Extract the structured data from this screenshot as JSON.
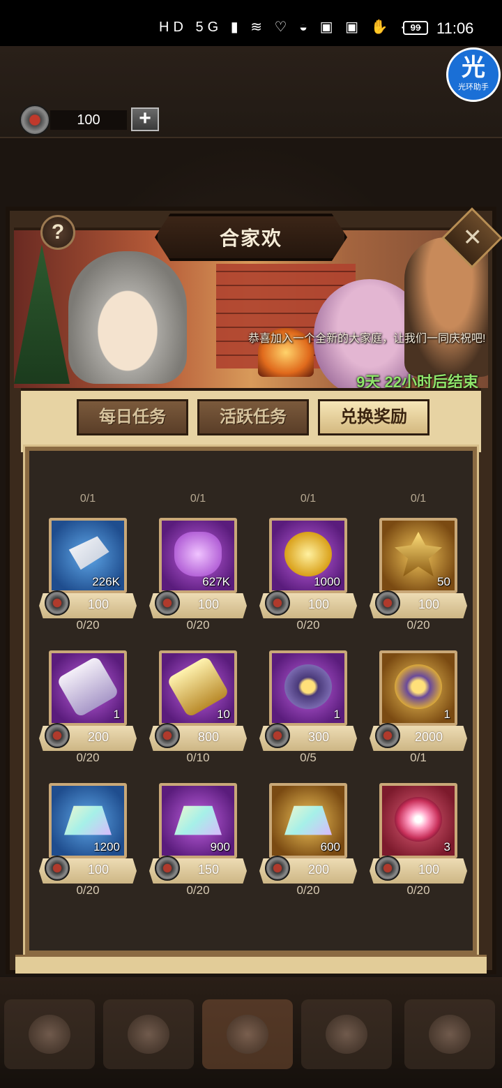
{
  "status_bar": {
    "icons": "HD 5G ▮ ≋ ♡ ◒ ▣ ▣ ✋ ···",
    "battery": "99",
    "time": "11:06"
  },
  "currency": {
    "value": "100",
    "add_symbol": "+"
  },
  "assistant_badge": {
    "glyph": "光",
    "label": "光环助手"
  },
  "event": {
    "title": "合家欢",
    "help_symbol": "?",
    "close_symbol": "✕",
    "message": "恭喜加入一个全新的大家庭，让我们一同庆祝吧!",
    "timer": "9天 22小时后结束"
  },
  "tabs": [
    {
      "label": "每日任务",
      "active": false
    },
    {
      "label": "活跃任务",
      "active": false
    },
    {
      "label": "兑换奖励",
      "active": true
    }
  ],
  "top_limits": [
    "0/1",
    "0/1",
    "0/1",
    "0/1"
  ],
  "items": [
    {
      "icon": "silver-ingot-icon",
      "rarity": "blue",
      "qty": "226K",
      "price": "100",
      "count": "0/20"
    },
    {
      "icon": "potion-bag-icon",
      "rarity": "purple",
      "qty": "627K",
      "price": "100",
      "count": "0/20"
    },
    {
      "icon": "gold-coin-icon",
      "rarity": "purple",
      "qty": "1000",
      "price": "100",
      "count": "0/20"
    },
    {
      "icon": "star-crystal-icon",
      "rarity": "gold",
      "qty": "50",
      "price": "100",
      "count": "0/20"
    },
    {
      "icon": "scroll-icon",
      "rarity": "purple",
      "qty": "1",
      "price": "200",
      "count": "0/20"
    },
    {
      "icon": "gold-scroll-icon",
      "rarity": "purple",
      "qty": "10",
      "price": "800",
      "count": "0/10"
    },
    {
      "icon": "medal-icon",
      "rarity": "purple",
      "qty": "1",
      "price": "300",
      "count": "0/5"
    },
    {
      "icon": "gold-medal-icon",
      "rarity": "gold",
      "qty": "1",
      "price": "2000",
      "count": "0/1"
    },
    {
      "icon": "crystal-shard-icon",
      "rarity": "blue",
      "qty": "1200",
      "price": "100",
      "count": "0/20"
    },
    {
      "icon": "crystal-shard-icon",
      "rarity": "purple",
      "qty": "900",
      "price": "150",
      "count": "0/20"
    },
    {
      "icon": "crystal-shard-icon",
      "rarity": "gold",
      "qty": "600",
      "price": "200",
      "count": "0/20"
    },
    {
      "icon": "swirl-orb-icon",
      "rarity": "red",
      "qty": "3",
      "price": "100",
      "count": "0/20"
    }
  ],
  "colors": {
    "blue_rarity": "#1f4d8e",
    "purple_rarity": "#5a1c7c",
    "gold_rarity": "#7a4a12",
    "red_rarity": "#7c1a2c",
    "timer": "#8fe36a"
  }
}
